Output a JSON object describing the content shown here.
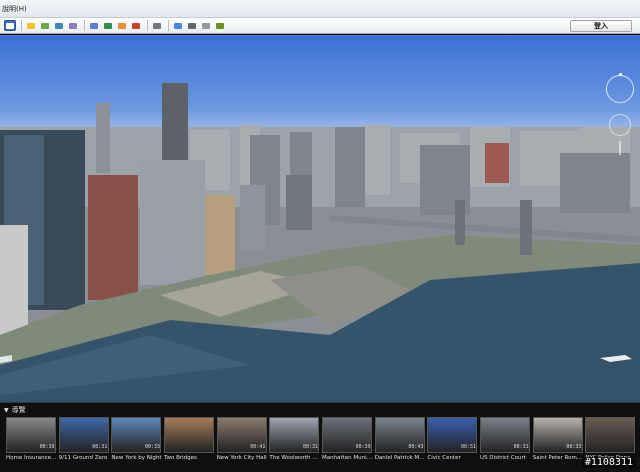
{
  "menubar": {
    "items": [
      "說明(H)"
    ]
  },
  "toolbar": {
    "buttons": [
      {
        "icon": "sidebar-toggle-icon",
        "color": "#ffffff",
        "active": true
      },
      {
        "icon": "placemark-icon",
        "color": "#f4c430"
      },
      {
        "icon": "polygon-icon",
        "color": "#6aa84f"
      },
      {
        "icon": "path-icon",
        "color": "#3d85c6"
      },
      {
        "icon": "image-overlay-icon",
        "color": "#8e7cc3"
      },
      {
        "icon": "record-tour-icon",
        "color": "#5b7bd6"
      },
      {
        "icon": "historical-imagery-icon",
        "color": "#2f8f4e"
      },
      {
        "icon": "sunlight-icon",
        "color": "#e69138"
      },
      {
        "icon": "planets-icon",
        "color": "#cc4125"
      },
      {
        "icon": "ruler-icon",
        "color": "#777777"
      },
      {
        "icon": "email-icon",
        "color": "#4a86e8"
      },
      {
        "icon": "print-icon",
        "color": "#666666"
      },
      {
        "icon": "save-image-icon",
        "color": "#999999"
      },
      {
        "icon": "view-in-maps-icon",
        "color": "#6b8e23"
      }
    ],
    "login_label": "登入"
  },
  "tour_panel": {
    "header": "導覽",
    "tours": [
      {
        "title": "Home Insurance Building",
        "duration": "00:39",
        "color": "#8a8a8a"
      },
      {
        "title": "9/11 Ground Zero",
        "duration": "00:31",
        "color": "#3f66a8"
      },
      {
        "title": "New York by Night",
        "duration": "00:33",
        "color": "#5f86b8"
      },
      {
        "title": "Two Bridges",
        "duration": "",
        "color": "#a37d5a"
      },
      {
        "title": "New York City Hall",
        "duration": "00:41",
        "color": "#8c7a6e"
      },
      {
        "title": "The Woolworth Building",
        "duration": "00:31",
        "color": "#9fa6b3"
      },
      {
        "title": "Manhattan Municipal Building",
        "duration": "00:39",
        "color": "#6d737c"
      },
      {
        "title": "Daniel Patrick Moynihan",
        "duration": "00:43",
        "color": "#7d858f"
      },
      {
        "title": "Civic Center",
        "duration": "00:51",
        "color": "#3c5fb0"
      },
      {
        "title": "US District Court",
        "duration": "00:31",
        "color": "#7b8088"
      },
      {
        "title": "Saint Peter Roman Catholic",
        "duration": "00:33",
        "color": "#b7b2aa"
      },
      {
        "title": "NYC Police Department",
        "duration": "",
        "color": "#6a5c52"
      }
    ]
  },
  "watermark": "#1108311"
}
